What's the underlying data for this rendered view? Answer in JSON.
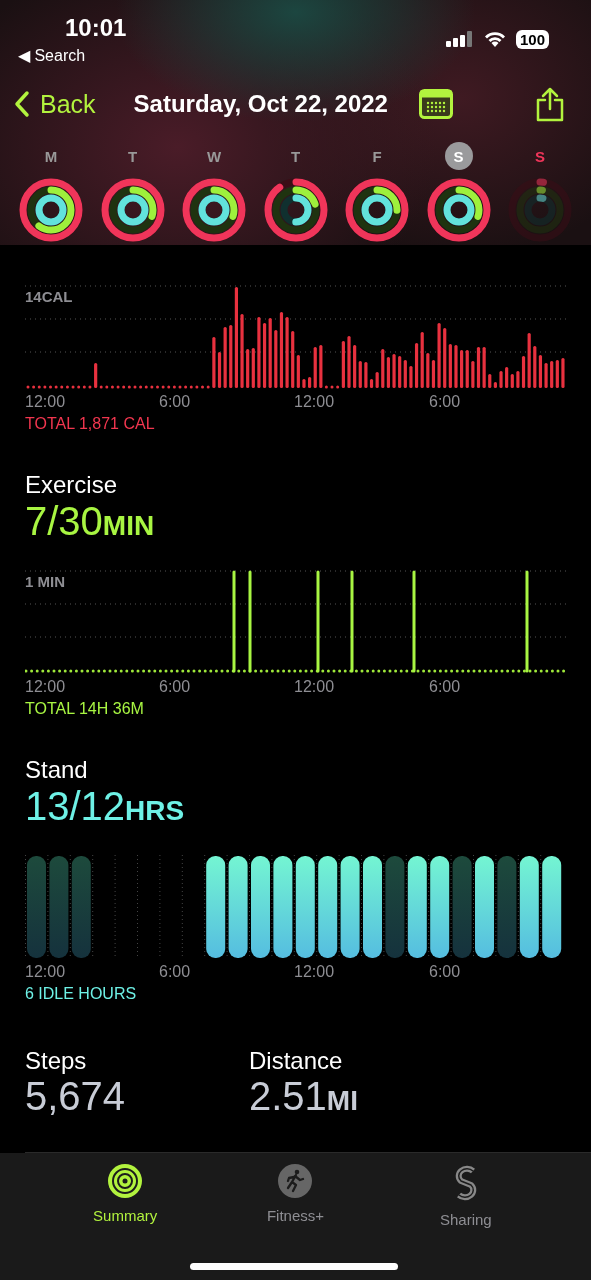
{
  "status_bar": {
    "time": "10:01",
    "back_app": "◀ Search",
    "battery": "100"
  },
  "nav": {
    "back": "Back",
    "title": "Saturday, Oct 22, 2022"
  },
  "week": [
    {
      "day": "M",
      "selected": false,
      "today": false
    },
    {
      "day": "T",
      "selected": false,
      "today": false
    },
    {
      "day": "W",
      "selected": false,
      "today": false
    },
    {
      "day": "T",
      "selected": false,
      "today": false
    },
    {
      "day": "F",
      "selected": false,
      "today": false
    },
    {
      "day": "S",
      "selected": true,
      "today": false
    },
    {
      "day": "S",
      "selected": false,
      "today": true
    }
  ],
  "sections": [
    {
      "kind": "move",
      "scale_label": "14CAL",
      "x_labels": [
        "12:00",
        "6:00",
        "12:00",
        "6:00"
      ],
      "total": "TOTAL 1,871 CAL"
    },
    {
      "kind": "exercise",
      "title": "Exercise",
      "value": "7/30",
      "unit": "MIN",
      "scale_label": "1 MIN",
      "x_labels": [
        "12:00",
        "6:00",
        "12:00",
        "6:00"
      ],
      "total": "TOTAL 14H 36M"
    },
    {
      "kind": "stand",
      "title": "Stand",
      "value": "13/12",
      "unit": "HRS",
      "x_labels": [
        "12:00",
        "6:00",
        "12:00",
        "6:00"
      ],
      "total": "6 IDLE HOURS"
    }
  ],
  "stats": [
    {
      "label": "Steps",
      "value": "5,674"
    },
    {
      "label": "Distance",
      "value": "2.51",
      "unit": "MI"
    }
  ],
  "tab_bar": [
    {
      "label": "Summary",
      "kind": "summary",
      "selected": true
    },
    {
      "label": "Fitness+",
      "kind": "fitness",
      "selected": false
    },
    {
      "label": "Sharing",
      "kind": "sharing",
      "selected": false
    }
  ]
}
